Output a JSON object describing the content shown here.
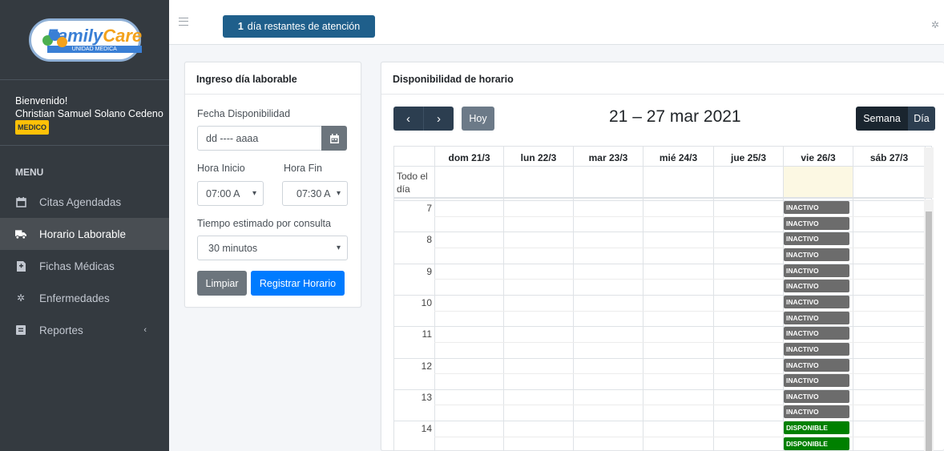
{
  "brand": {
    "name_part1": "Family",
    "name_part2": "Care",
    "subtitle": "UNIDAD MEDICA"
  },
  "user": {
    "greeting": "Bienvenido!",
    "name": "Christian Samuel Solano Cedeno",
    "role": "MEDICO"
  },
  "menu": {
    "header": "MENU",
    "items": [
      {
        "label": "Citas Agendadas",
        "icon": "calendar-icon",
        "active": false
      },
      {
        "label": "Horario Laborable",
        "icon": "truck-icon",
        "active": true
      },
      {
        "label": "Fichas Médicas",
        "icon": "file-icon",
        "active": false
      },
      {
        "label": "Enfermedades",
        "icon": "virus-icon",
        "active": false
      },
      {
        "label": "Reportes",
        "icon": "report-icon",
        "active": false
      }
    ]
  },
  "topbar": {
    "days_count": "1",
    "days_text": "día restantes de atención"
  },
  "form": {
    "title": "Ingreso día laborable",
    "date_label": "Fecha Disponibilidad",
    "date_value": "dd ---- aaaa",
    "start_label": "Hora Inicio",
    "start_value": "07:00 A",
    "end_label": "Hora Fin",
    "end_value": "07:30 A",
    "duration_label": "Tiempo estimado por consulta",
    "duration_value": "30 minutos",
    "clear_button": "Limpiar",
    "submit_button": "Registrar Horario"
  },
  "calendar": {
    "title": "Disponibilidad de horario",
    "today_button": "Hoy",
    "range": "21 – 27 mar 2021",
    "view_week": "Semana",
    "view_day": "Día",
    "allday_label": "Todo el día",
    "days": [
      "dom 21/3",
      "lun 22/3",
      "mar 23/3",
      "mié 24/3",
      "jue 25/3",
      "vie 26/3",
      "sáb 27/3"
    ],
    "hours": [
      "7",
      "8",
      "9",
      "10",
      "11",
      "12",
      "13",
      "14"
    ],
    "events": [
      {
        "label": "INACTIVO",
        "status": "inactive"
      },
      {
        "label": "INACTIVO",
        "status": "inactive"
      },
      {
        "label": "INACTIVO",
        "status": "inactive"
      },
      {
        "label": "INACTIVO",
        "status": "inactive"
      },
      {
        "label": "INACTIVO",
        "status": "inactive"
      },
      {
        "label": "INACTIVO",
        "status": "inactive"
      },
      {
        "label": "INACTIVO",
        "status": "inactive"
      },
      {
        "label": "INACTIVO",
        "status": "inactive"
      },
      {
        "label": "INACTIVO",
        "status": "inactive"
      },
      {
        "label": "INACTIVO",
        "status": "inactive"
      },
      {
        "label": "INACTIVO",
        "status": "inactive"
      },
      {
        "label": "INACTIVO",
        "status": "inactive"
      },
      {
        "label": "INACTIVO",
        "status": "inactive"
      },
      {
        "label": "INACTIVO",
        "status": "inactive"
      },
      {
        "label": "DISPONIBLE",
        "status": "available"
      },
      {
        "label": "DISPONIBLE",
        "status": "available"
      }
    ]
  },
  "colors": {
    "inactive": "#6c6c6c",
    "available": "#008000",
    "primary": "#007bff",
    "navy": "#1f5f8b"
  }
}
